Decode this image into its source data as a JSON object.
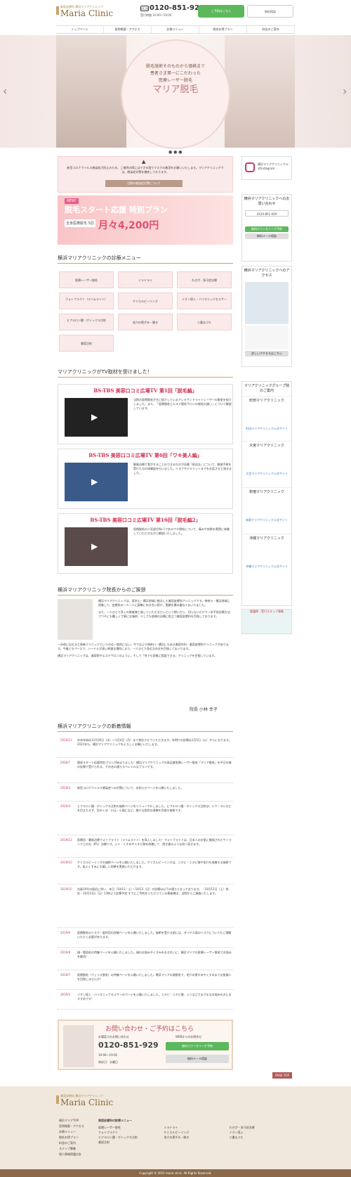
{
  "header": {
    "logo_sub": "美容皮膚科 横浜マリアクリニック",
    "logo": "Maria Clinic",
    "tel_icon": "0120",
    "tel": "0120-851-929",
    "hours": "受付時間 10:00～19:00",
    "btn_counsel": "ご予約はこちら",
    "btn_mail": "無料相談"
  },
  "nav": [
    "トップページ",
    "医院概要・アクセス",
    "診療メニュー",
    "脱毛お得プラン",
    "料金のご案内"
  ],
  "hero": {
    "line1": "脱毛施術そのものから価格まで",
    "line2": "患者さま第一にこだわった",
    "line3": "医療レーザー脱毛",
    "title": "マリア脱毛",
    "prev": "‹",
    "next": "›",
    "dots": "● ● ●"
  },
  "notice": {
    "text": "新型コロナウイルス感染拡大防止のため、ご来院の際にはできる限りマスクの着用をお願いいたします。マリアクリニックでは、感染症対策を徹底しております。",
    "button": "当院の感染症対策について"
  },
  "banner": {
    "new": "NEW!",
    "title": "脱毛スタート応援 特別プラン",
    "sub": "全身医療脱毛 5回",
    "price": "月々4,200円"
  },
  "menu": {
    "title": "横浜マリアクリニックの診療メニュー",
    "items": [
      "医療レーザー脱毛",
      "ミラドライ",
      "わきが・多汗症治療",
      "フォトフラクト（ライムライト）",
      "ケミカルピーリング",
      "イオン導入・バイオニックセルサー",
      "ヒアルロン酸・ボトックス注射",
      "毛穴の黒ずみ・開き",
      "二重まぶた",
      "美容注射"
    ]
  },
  "tv": {
    "title": "マリアクリニックがTV取材を受けました！",
    "items": [
      {
        "title": "BS-TBS 美容口コミ広場TV 第1回「脱毛編」",
        "desc": "当院の医療脱毛が主に紹介しているアレキサンドライトレーザーの脱毛を紹介しました。また、「医療脱毛とエステ脱毛サロンの脱毛の違い」について解説しています。"
      },
      {
        "title": "BS-TBS 美容口コミ広場TV 第6回「ワキ美人編」",
        "desc": "腋臭治療で我がすることのできるわきが治療「根治法」について、腋臭手術を受けた方の体験談を行いました。リスクやデメリットまでをお話させて頂きました。"
      },
      {
        "title": "BS-TBS 美容口コミ広場TV 第16回「脱毛編2」",
        "desc": "医療脱毛の人気部位No.1であるワキ脱毛について、痛みや効果を実際に体験していただきながら解説いたしました。"
      }
    ]
  },
  "greeting": {
    "title": "横浜マリアクリニック院長からのご挨拶",
    "p1": "横浜マリアクリニックは、東京山・横浜地域に拠点した美容皮膚科クリニックです。神奈川・横浜地域に密着して、皮膚科の一人一人に真摯に向き合い続け、実績を積み重ねてまいりました。",
    "p2": "また、一人ひとり多くの患者様と接していただきたいという想いから、切らないだけで一歩手前治療方法でウチにも難しく丁寧にお施術、少しでも皆様の治療に役立つ美容皮膚科を目指しております。",
    "p3": "一歩前に出せると患者クリニックというのは一般的にない。今ではより神奈川・横浜にもある美容外科・美容皮膚科クリニックがあります。今後ともペースで、ハードルが高い刺激な場所にまり、一人ひとり身近な存在を目指してまいります。",
    "p4": "横浜マリアクリニックは、美容院やエステサロンのように、そして「何でも気軽に相談できる」クリニックを目指しています。",
    "sign": "院長 小林 幸子"
  },
  "news": {
    "title": "横浜マリアクリニックの新着情報",
    "items": [
      {
        "date": "2020/12",
        "text": "年末年始は12月30日（水）～1月4日（月）まで休診させていただきます。年明けの診療は1月5日（火）からになります。2021年も、横浜マリアクリニックをよろしくお願いいたします。"
      },
      {
        "date": "2020/7",
        "text": "脱毛スタート応援特別プランが始まりました！横浜マリアクリニックの高品質医療レーザー脱毛「マリア脱毛」を平日の夜の診療で受けられる、その名の通りスペシャルなプランです。"
      },
      {
        "date": "2020/3",
        "text": "新型コロナウイルス感染症への対策について、お知らせページを公開いたしました。"
      },
      {
        "date": "2020/4",
        "text": "ヒアルロン酸・ボトックス注射の施術ページをリニューアルしました。ヒアルロン酸・ボトックス注射は、シワ・ヨシなどを目立たせず、目のくぼ・口元・小顔になど、様々な症状の改善を目指す施術です。"
      },
      {
        "date": "2019/12",
        "text": "医療用・最新治療フォトブライト（ライムライト）を導入しました！フォトブライトは、日本人のお肌に開発されたワンランク上の光（IPL）治療です。シミ・くすみやニキビ跡を改善して、透き通るような肌へ導きます。"
      },
      {
        "date": "2019/10",
        "text": "ケミカルピーリングの施術ページを公開いたしました。ケミカルピーリングは、ニキビ・ニキビ跡や毛穴を改善する施術です。皮ふくすみにも嬉しい効果を実感いただけます。"
      },
      {
        "date": "2019/10",
        "text": "台風19号の接近に伴い、本日（10/12・土）・10/13（日）の診療は以下の通りとなっております。・10月12日（土）休診・10月13日（日）13時より診療予定 すでにご予約をいただいている患者様は、当院からご連絡いたします。"
      },
      {
        "date": "2019/9",
        "text": "医療脱毛のリスク・副作用の詳細ページを公開いたしました。施術を受ける前には、ダイヤス面のリスクについてもご理解いただく必要があります。"
      },
      {
        "date": "2019/8",
        "text": "顔・脂肌毛の特集ページを公開いたしました。顔のお悩みやくすみをおきれいに、横浜マリアの医療レーザー脱毛でお悩みを解消！"
      },
      {
        "date": "2019/7",
        "text": "医療脱毛（フェイス脱毛）の特集ページを公開いたしました。横浜マリアの顔脱毛で、毛穴の黒ずみやくすみまでお肌美人を目指しませんか？"
      },
      {
        "date": "2019/3",
        "text": "イオン導入・バイオニックセルサーのページを公開いたしました。ニキビ・ニキビ跡、シミなどさまざまなお悩みの方におすすめです！"
      }
    ]
  },
  "cta": {
    "title": "お問い合わせ・ご予約はこちら",
    "sub1": "お電話でのお問い合わせ",
    "sub2": "WEBからのお問合せ",
    "tel": "0120-851-929",
    "hours": "10:00～19:00",
    "closed": "休診日：水曜日",
    "btn1": "無料カウンセリング予約",
    "btn2": "無料メール相談"
  },
  "pagetop": "PAGE TOP",
  "sidebar": {
    "insta": "横浜マリアクリニック公式Instagram",
    "contact_h": "横浜マリアクリニックへのお問い合わせ",
    "tel": "0120-851-929",
    "btn1": "無料カウンセリング予約",
    "btn2": "無料メール相談",
    "access_h": "横浜マリアクリニックへのアクセス",
    "access_btn": "詳しいアクセスはこちら",
    "group_h": "マリアクリニックグループ院のご案内",
    "groups": [
      {
        "name": "町田マリアクリニック",
        "btn": "町田マリアクリニック公式サイト"
      },
      {
        "name": "大宮マリアクリニック",
        "btn": "大宮マリアクリニック公式サイト"
      },
      {
        "name": "新宿マリアクリニック",
        "btn": "新宿マリアクリニック公式サイト"
      },
      {
        "name": "沖縄マリアクリニック",
        "btn": "沖縄マリアクリニック公式サイト"
      }
    ],
    "recruit": "看護師・受付スタッフ募集"
  },
  "footer": {
    "logo_sub": "美容皮膚科 横浜マリアクリニック",
    "logo": "Maria Clinic",
    "col1": [
      "横浜マリアTOP",
      "医院概要・アクセス",
      "診療メニュー",
      "脱毛お得プラン",
      "料金のご案内",
      "ステップ募集",
      "個人情報保護方針"
    ],
    "col2_h": "美容皮膚科の診療メニュー",
    "col2": [
      "医療レーザー脱毛",
      "ミラドライ",
      "わきが・多汗症治療",
      "フォトフラクト",
      "ケミカルピーリング",
      "イオン導入",
      "ヒアルロン酸・ボトックス注射",
      "毛穴の黒ずみ・開き",
      "二重まぶた",
      "美容注射"
    ],
    "copyright": "Copyright © 2015 maria clinic. All Rights Reserved."
  },
  "colors": {
    "accent": "#c04050",
    "gold": "#c9a36a",
    "green": "#5cb85c"
  }
}
